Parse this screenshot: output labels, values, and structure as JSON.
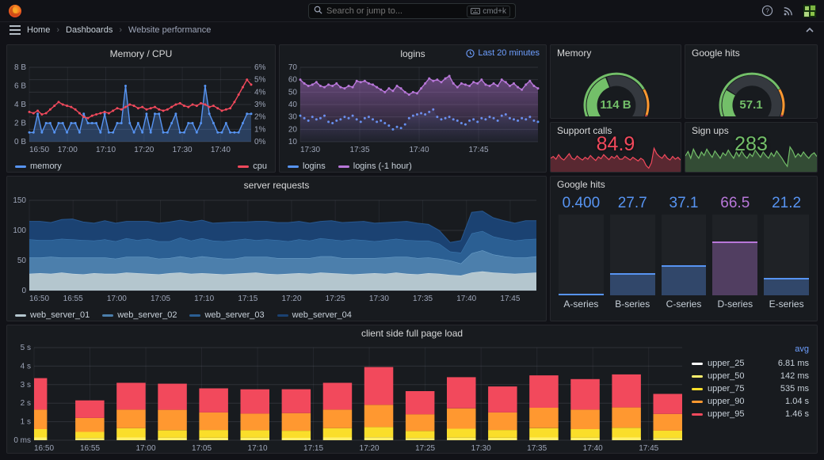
{
  "header": {
    "search_placeholder": "Search or jump to...",
    "shortcut": "cmd+k"
  },
  "breadcrumb": {
    "items": [
      "Home",
      "Dashboards",
      "Website performance"
    ]
  },
  "colors": {
    "blue": "#5794F2",
    "red": "#F2495C",
    "green": "#73BF69",
    "orange": "#FF9830",
    "purple": "#B877D9",
    "yellow": "#FADE2A",
    "pale_yellow": "#FFF06E",
    "white": "#FFFFFF",
    "link_blue": "#6E9FFF"
  },
  "chart_data": [
    {
      "id": "memory_cpu",
      "type": "line",
      "title": "Memory / CPU",
      "x_ticks": [
        "16:50",
        "17:00",
        "17:10",
        "17:20",
        "17:30",
        "17:40"
      ],
      "x_tick_pos": [
        0,
        0.1724,
        0.3448,
        0.5172,
        0.6897,
        0.8621
      ],
      "grid_count": 7,
      "y_left": {
        "labels": [
          "8 B",
          "6 B",
          "4 B",
          "2 B",
          "0 B"
        ],
        "min": 0,
        "max": 8
      },
      "y_right": {
        "labels": [
          "6%",
          "5%",
          "4%",
          "3%",
          "2%",
          "1%",
          "0%"
        ],
        "min": 0,
        "max": 6
      },
      "series": [
        {
          "name": "memory",
          "color": "#5794F2",
          "axis": "left",
          "fill": true,
          "fill_opacity": 0.3,
          "dots": true,
          "values": [
            1,
            1,
            3,
            1,
            2,
            2,
            1,
            2,
            2,
            1,
            2,
            2,
            1,
            3,
            2,
            2,
            2,
            1,
            3,
            1,
            1,
            2,
            2,
            6,
            2,
            1,
            2,
            1,
            3,
            1,
            3,
            3,
            1,
            1,
            2,
            3,
            1,
            1,
            2,
            2,
            1,
            2,
            6,
            3,
            2,
            1,
            1,
            2,
            1,
            1,
            1,
            2,
            3,
            3
          ]
        },
        {
          "name": "cpu",
          "color": "#F2495C",
          "axis": "right",
          "fill": false,
          "dots": true,
          "values": [
            2.4,
            2.3,
            2.5,
            2.2,
            2.3,
            2.6,
            2.9,
            3.2,
            3.0,
            2.9,
            2.8,
            2.6,
            2.3,
            2.0,
            1.9,
            2.1,
            2.2,
            2.3,
            2.4,
            2.3,
            2.5,
            2.7,
            2.6,
            2.8,
            3.0,
            2.9,
            2.7,
            2.8,
            2.6,
            2.7,
            2.8,
            2.6,
            2.5,
            2.6,
            2.8,
            3.0,
            3.1,
            2.9,
            2.8,
            3.0,
            2.9,
            3.1,
            3.0,
            2.8,
            2.9,
            2.7,
            2.5,
            2.6,
            2.7,
            3.2,
            3.8,
            4.4,
            5.0,
            4.6
          ]
        }
      ]
    },
    {
      "id": "logins",
      "type": "line",
      "title": "logins",
      "time_range": "Last 20 minutes",
      "x_ticks": [
        "17:30",
        "17:35",
        "17:40",
        "17:45"
      ],
      "x_tick_pos": [
        0,
        0.25,
        0.5,
        0.75
      ],
      "grid_count": 7,
      "y_left": {
        "labels": [
          "70",
          "60",
          "50",
          "40",
          "30",
          "20",
          "10"
        ],
        "min": 10,
        "max": 70
      },
      "series": [
        {
          "name": "logins",
          "color": "#5794F2",
          "axis": "left",
          "style": "dots",
          "fill": true,
          "fill_opacity": 0.12,
          "gradient": true,
          "values": [
            31,
            29,
            27,
            30,
            28,
            29,
            31,
            26,
            25,
            27,
            28,
            30,
            29,
            31,
            28,
            26,
            29,
            30,
            28,
            26,
            27,
            25,
            23,
            20,
            22,
            21,
            24,
            29,
            31,
            32,
            33,
            32,
            34,
            36,
            30,
            28,
            29,
            30,
            28,
            27,
            25,
            24,
            27,
            28,
            26,
            29,
            28,
            30,
            29,
            27,
            31,
            32,
            29,
            28,
            27,
            29,
            28,
            30,
            27,
            26
          ]
        },
        {
          "name": "logins (-1 hour)",
          "color": "#B877D9",
          "axis": "left",
          "fill": true,
          "fill_opacity": 0.5,
          "gradient": true,
          "dots": true,
          "values": [
            60,
            57,
            55,
            56,
            58,
            55,
            54,
            56,
            55,
            57,
            54,
            53,
            55,
            54,
            59,
            58,
            59,
            57,
            56,
            54,
            52,
            50,
            53,
            51,
            55,
            53,
            50,
            48,
            50,
            49,
            53,
            57,
            61,
            59,
            60,
            58,
            61,
            63,
            57,
            54,
            57,
            56,
            55,
            58,
            57,
            60,
            56,
            55,
            57,
            55,
            60,
            58,
            55,
            57,
            54,
            52,
            56,
            59,
            55,
            53
          ]
        }
      ]
    },
    {
      "id": "memory_gauge",
      "type": "gauge",
      "title": "Memory",
      "display": "114 B",
      "fraction": 0.42,
      "thresholds": [
        {
          "to": 0.72,
          "color": "#73BF69"
        },
        {
          "to": 0.9,
          "color": "#FF9830"
        },
        {
          "to": 1,
          "color": "#F2495C"
        }
      ]
    },
    {
      "id": "google_gauge",
      "type": "gauge",
      "title": "Google hits",
      "display": "57.1",
      "fraction": 0.28,
      "thresholds": [
        {
          "to": 0.72,
          "color": "#73BF69"
        },
        {
          "to": 0.9,
          "color": "#FF9830"
        },
        {
          "to": 1,
          "color": "#F2495C"
        }
      ]
    },
    {
      "id": "support_calls",
      "type": "sparkline",
      "title": "Support calls",
      "display": "84.9",
      "color": "#F2495C",
      "values": [
        30,
        34,
        28,
        38,
        30,
        26,
        33,
        40,
        30,
        27,
        35,
        30,
        26,
        32,
        28,
        36,
        30,
        25,
        33,
        29,
        38,
        32,
        27,
        34,
        30,
        36,
        28,
        28,
        34,
        30,
        26,
        32,
        28,
        24,
        30,
        26,
        14,
        8,
        20,
        52,
        40,
        34,
        30,
        38,
        30,
        26,
        34,
        28,
        32,
        26
      ]
    },
    {
      "id": "sign_ups",
      "type": "sparkline",
      "title": "Sign ups",
      "display": "283",
      "color": "#73BF69",
      "values": [
        35,
        45,
        30,
        50,
        38,
        30,
        44,
        36,
        50,
        40,
        32,
        46,
        38,
        30,
        42,
        36,
        48,
        38,
        30,
        44,
        34,
        46,
        36,
        30,
        40,
        34,
        48,
        40,
        32,
        44,
        36,
        30,
        42,
        34,
        46,
        38,
        30,
        20,
        12,
        55,
        46,
        32,
        40,
        34,
        44,
        36,
        30,
        38,
        42,
        34
      ]
    },
    {
      "id": "server_requests",
      "type": "area",
      "stacked": true,
      "title": "server requests",
      "x_ticks": [
        "16:50",
        "16:55",
        "17:00",
        "17:05",
        "17:10",
        "17:15",
        "17:20",
        "17:25",
        "17:30",
        "17:35",
        "17:40",
        "17:45"
      ],
      "x_tick_pos": [
        0,
        0.0862,
        0.1724,
        0.2586,
        0.3448,
        0.431,
        0.5172,
        0.6034,
        0.6897,
        0.7759,
        0.8621,
        0.9483
      ],
      "grid_count": 4,
      "y_left": {
        "labels": [
          "150",
          "100",
          "50",
          "0"
        ],
        "min": 0,
        "max": 150
      },
      "series": [
        {
          "name": "web_server_01",
          "fill": "#B4C6CE",
          "color": "#D0DEE4",
          "values": [
            28,
            29,
            28,
            30,
            28,
            27,
            29,
            28,
            28,
            30,
            29,
            28,
            27,
            29,
            30,
            28,
            29,
            28,
            27,
            28,
            29,
            30,
            28,
            27,
            28,
            29,
            28,
            30,
            29,
            28,
            27,
            28,
            29,
            28,
            30,
            28,
            27,
            29,
            28,
            26,
            25,
            30,
            32,
            30,
            29,
            28,
            29,
            30
          ]
        },
        {
          "name": "web_server_02",
          "fill": "#4C7FAC",
          "color": "#6FA3CC",
          "values": [
            27,
            26,
            28,
            25,
            27,
            28,
            26,
            27,
            25,
            26,
            27,
            28,
            26,
            25,
            27,
            26,
            28,
            27,
            26,
            25,
            27,
            26,
            28,
            27,
            26,
            25,
            26,
            27,
            28,
            26,
            27,
            26,
            25,
            27,
            26,
            28,
            27,
            26,
            25,
            24,
            20,
            32,
            35,
            30,
            28,
            27,
            26,
            27
          ]
        },
        {
          "name": "web_server_03",
          "fill": "#2B5F93",
          "color": "#3F7CB5",
          "values": [
            30,
            29,
            28,
            31,
            30,
            29,
            28,
            30,
            29,
            31,
            28,
            30,
            29,
            28,
            31,
            29,
            30,
            28,
            29,
            31,
            30,
            28,
            29,
            30,
            28,
            31,
            29,
            30,
            28,
            29,
            31,
            30,
            28,
            29,
            30,
            28,
            29,
            28,
            25,
            15,
            18,
            33,
            32,
            30,
            29,
            28,
            30,
            29
          ]
        },
        {
          "name": "web_server_04",
          "fill": "#1B4272",
          "color": "#27578F",
          "values": [
            30,
            31,
            29,
            32,
            34,
            30,
            29,
            31,
            30,
            28,
            31,
            29,
            30,
            32,
            29,
            31,
            30,
            29,
            31,
            30,
            28,
            31,
            30,
            29,
            31,
            30,
            29,
            28,
            31,
            30,
            29,
            31,
            30,
            29,
            28,
            31,
            29,
            27,
            22,
            15,
            20,
            35,
            33,
            31,
            30,
            29,
            31,
            30
          ]
        }
      ]
    },
    {
      "id": "google_hits_bars",
      "type": "bar",
      "title": "Google hits",
      "categories": [
        "A-series",
        "B-series",
        "C-series",
        "D-series",
        "E-series"
      ],
      "values": [
        0.4,
        27.7,
        37.1,
        66.5,
        21.2
      ],
      "display_values": [
        "0.400",
        "27.7",
        "37.1",
        "66.5",
        "21.2"
      ],
      "bar_colors": [
        "#5794F2",
        "#5794F2",
        "#5794F2",
        "#B877D9",
        "#5794F2"
      ],
      "ylim": [
        0,
        100
      ]
    },
    {
      "id": "page_load",
      "type": "bar",
      "stacked": true,
      "title": "client side full page load",
      "x_ticks": [
        "16:50",
        "16:55",
        "17:00",
        "17:05",
        "17:10",
        "17:15",
        "17:20",
        "17:25",
        "17:30",
        "17:35",
        "17:40",
        "17:45"
      ],
      "x_tick_pos": [
        0,
        0.0862,
        0.1724,
        0.2586,
        0.3448,
        0.431,
        0.5172,
        0.6034,
        0.6897,
        0.7759,
        0.8621,
        0.9483
      ],
      "y_left": {
        "labels": [
          "5 s",
          "4 s",
          "3 s",
          "2 s",
          "1 s",
          "0 ms"
        ],
        "min": 0,
        "max": 5
      },
      "segment_colors": [
        "#FFF06E",
        "#FADE2A",
        "#FF9830",
        "#F2495C"
      ],
      "bars": [
        [
          0.15,
          0.45,
          1.05,
          1.7
        ],
        [
          0.12,
          0.33,
          0.75,
          0.95
        ],
        [
          0.15,
          0.5,
          1.0,
          1.45
        ],
        [
          0.14,
          0.4,
          1.1,
          1.41
        ],
        [
          0.13,
          0.42,
          0.95,
          1.3
        ],
        [
          0.14,
          0.4,
          0.9,
          1.31
        ],
        [
          0.13,
          0.38,
          0.95,
          1.29
        ],
        [
          0.15,
          0.5,
          1.0,
          1.45
        ],
        [
          0.16,
          0.55,
          1.2,
          2.04
        ],
        [
          0.12,
          0.38,
          0.9,
          1.25
        ],
        [
          0.14,
          0.48,
          1.1,
          1.68
        ],
        [
          0.13,
          0.42,
          0.95,
          1.4
        ],
        [
          0.15,
          0.5,
          1.1,
          1.75
        ],
        [
          0.14,
          0.46,
          1.05,
          1.65
        ],
        [
          0.15,
          0.52,
          1.1,
          1.78
        ],
        [
          0.12,
          0.4,
          0.9,
          1.08
        ]
      ],
      "legend_header": "avg",
      "legend": [
        {
          "name": "upper_25",
          "value": "6.81 ms",
          "color": "#FFFFFF"
        },
        {
          "name": "upper_50",
          "value": "142 ms",
          "color": "#FFF06E"
        },
        {
          "name": "upper_75",
          "value": "535 ms",
          "color": "#FADE2A"
        },
        {
          "name": "upper_90",
          "value": "1.04 s",
          "color": "#FF9830"
        },
        {
          "name": "upper_95",
          "value": "1.46 s",
          "color": "#F2495C"
        }
      ]
    }
  ]
}
